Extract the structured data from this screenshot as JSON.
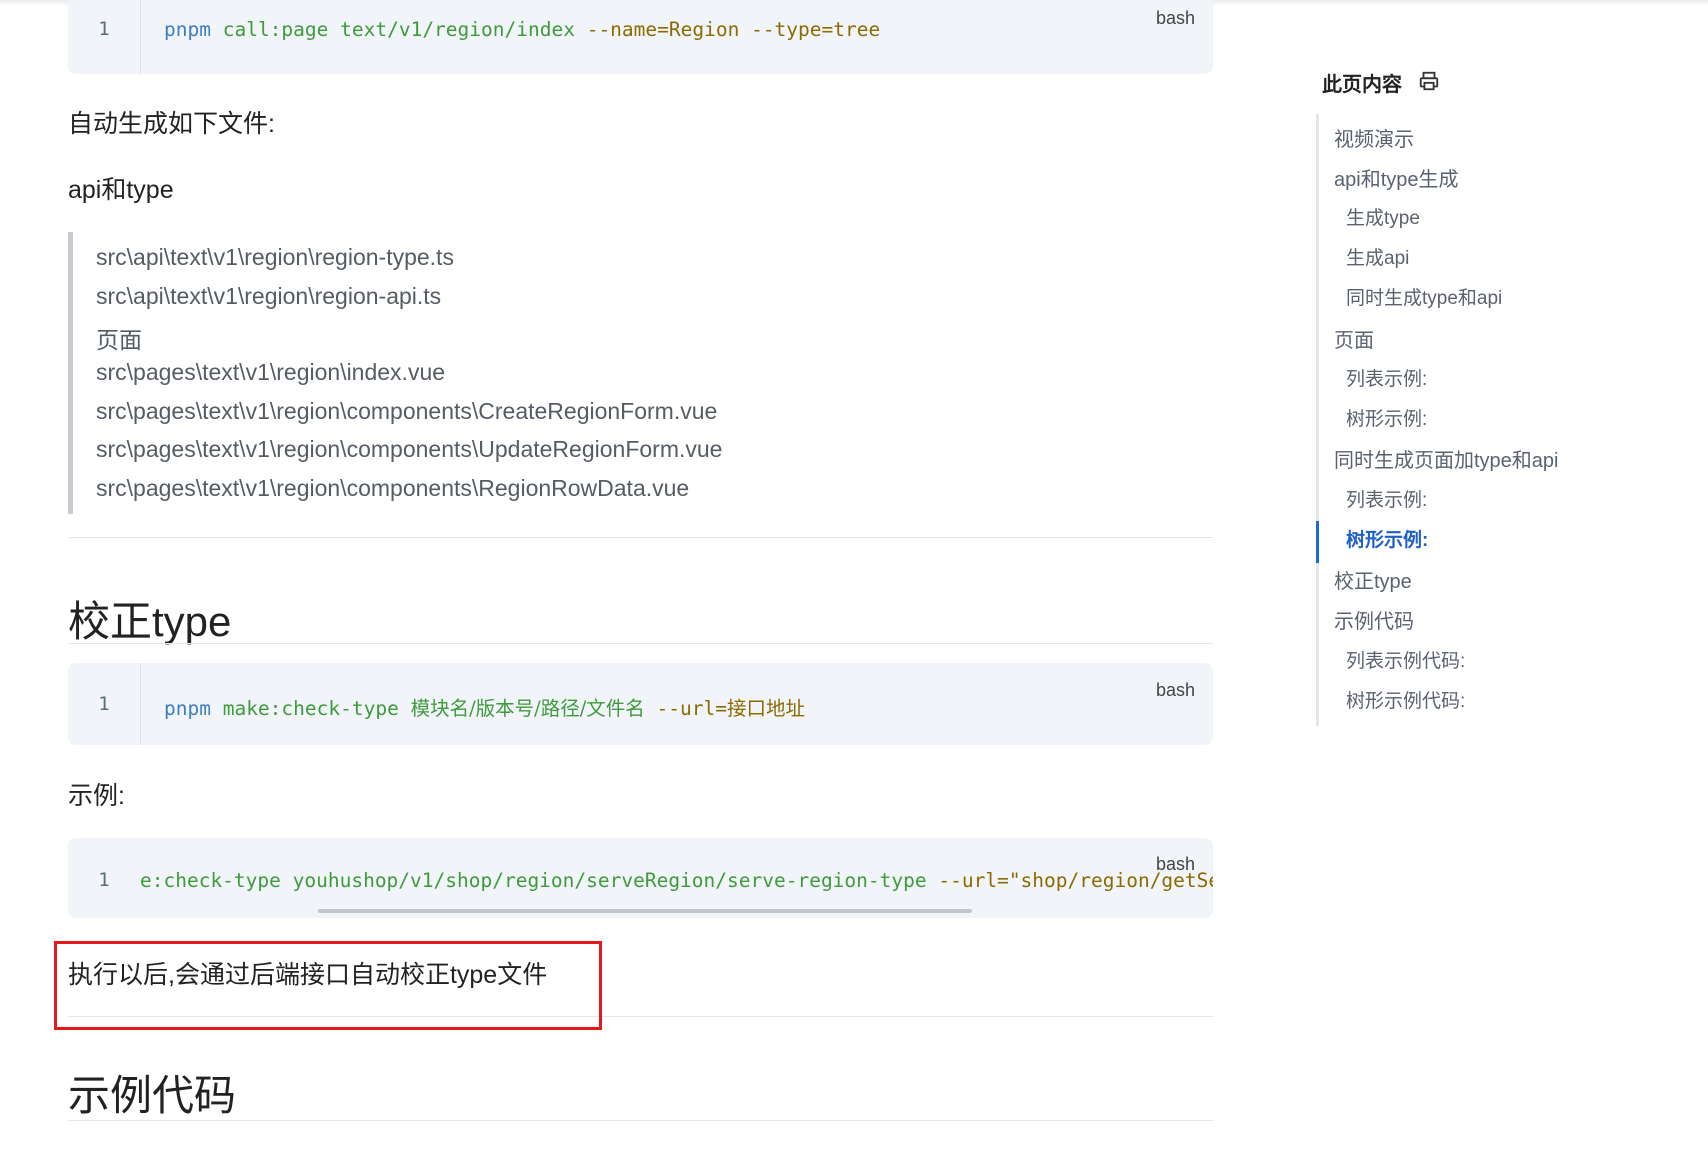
{
  "colors": {
    "code_bg": "#f1f5f9",
    "command_blue": "#3b7fbf",
    "arg_green": "#3f9a3c",
    "flag_olive": "#8c6a00",
    "active_link": "#1e5fc8",
    "highlight_box": "#e5161c"
  },
  "code_block_1": {
    "line_no": "1",
    "lang": "bash",
    "cmd": "pnpm",
    "sub": "call:page",
    "path": "text/v1/region/index",
    "flags": "--name=Region --type=tree"
  },
  "para_generated": "自动生成如下文件:",
  "para_api_type": "api和type",
  "file_list": [
    "src\\api\\text\\v1\\region\\region-type.ts",
    "src\\api\\text\\v1\\region\\region-api.ts",
    "页面",
    "src\\pages\\text\\v1\\region\\index.vue",
    "src\\pages\\text\\v1\\region\\components\\CreateRegionForm.vue",
    "src\\pages\\text\\v1\\region\\components\\UpdateRegionForm.vue",
    "src\\pages\\text\\v1\\region\\components\\RegionRowData.vue"
  ],
  "heading_check_type": "校正type",
  "code_block_2": {
    "line_no": "1",
    "lang": "bash",
    "cmd": "pnpm",
    "sub": "make:check-type",
    "args": "模块名/版本号/路径/文件名",
    "flag": "--url=",
    "flag_value": "接口地址"
  },
  "para_example": "示例:",
  "code_block_3": {
    "line_no": "1",
    "lang": "bash",
    "sub": "e:check-type",
    "path": "youhushop/v1/shop/region/serveRegion/serve-region-type",
    "flag": "--url=",
    "flag_value": "\"shop/region/getSer"
  },
  "para_note": "执行以后,会通过后端接口自动校正type文件",
  "heading_example_code": "示例代码",
  "sidebar": {
    "title": "此页内容",
    "print_icon": "printer-icon",
    "items": [
      {
        "label": "视频演示",
        "level": 1
      },
      {
        "label": "api和type生成",
        "level": 1
      },
      {
        "label": "生成type",
        "level": 2
      },
      {
        "label": "生成api",
        "level": 2
      },
      {
        "label": "同时生成type和api",
        "level": 2
      },
      {
        "label": "页面",
        "level": 1
      },
      {
        "label": "列表示例:",
        "level": 2
      },
      {
        "label": "树形示例:",
        "level": 2
      },
      {
        "label": "同时生成页面加type和api",
        "level": 1
      },
      {
        "label": "列表示例:",
        "level": 2
      },
      {
        "label": "树形示例:",
        "level": 2,
        "active": true
      },
      {
        "label": "校正type",
        "level": 1
      },
      {
        "label": "示例代码",
        "level": 1
      },
      {
        "label": "列表示例代码:",
        "level": 2
      },
      {
        "label": "树形示例代码:",
        "level": 2
      }
    ]
  }
}
